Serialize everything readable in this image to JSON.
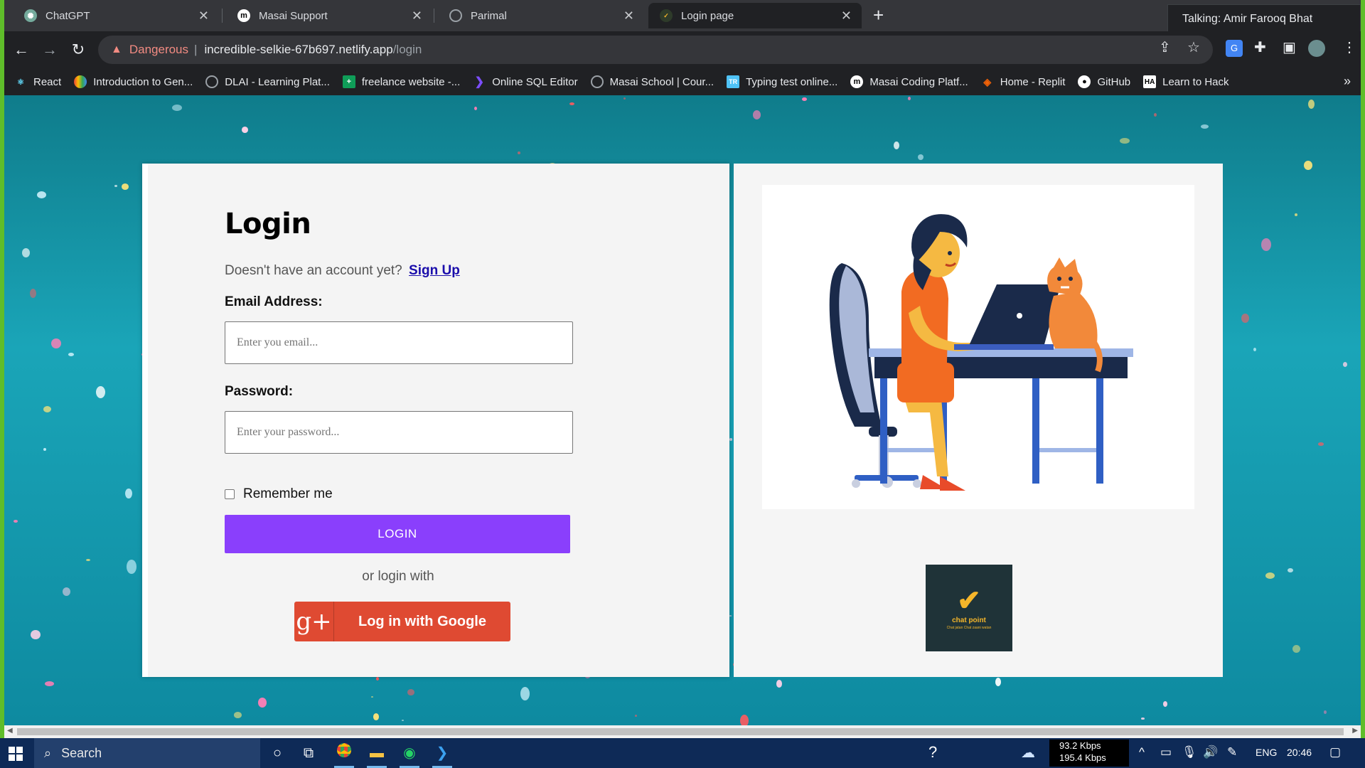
{
  "browser": {
    "tabs": [
      {
        "title": "ChatGPT",
        "icon": "chatgpt-icon",
        "active": false
      },
      {
        "title": "Masai Support",
        "icon": "masai-icon",
        "active": false
      },
      {
        "title": "Parimal",
        "icon": "globe-icon",
        "active": false
      },
      {
        "title": "Login page",
        "icon": "page-favicon",
        "active": true
      }
    ],
    "profile_chip": "Talking: Amir Farooq Bhat",
    "address": {
      "security_label": "Dangerous",
      "host": "incredible-selkie-67b697.netlify.app",
      "path": "/login"
    },
    "bookmarks": [
      {
        "label": "React",
        "icon": "react-icon",
        "color": "#61dafb"
      },
      {
        "label": "Introduction to Gen...",
        "icon": "gcloud-icon",
        "color": "#ea4335"
      },
      {
        "label": "DLAI - Learning Plat...",
        "icon": "globe-icon",
        "color": "#9aa0a6"
      },
      {
        "label": "freelance website -...",
        "icon": "plus-sheet-icon",
        "color": "#0f9d58"
      },
      {
        "label": "Online SQL Editor",
        "icon": "sql-icon",
        "color": "#7c4dff"
      },
      {
        "label": "Masai School | Cour...",
        "icon": "globe-icon",
        "color": "#9aa0a6"
      },
      {
        "label": "Typing test online...",
        "icon": "typing-icon",
        "color": "#4fc3f7"
      },
      {
        "label": "Masai Coding Platf...",
        "icon": "masai-icon",
        "color": "#ffffff"
      },
      {
        "label": "Home - Replit",
        "icon": "replit-icon",
        "color": "#f26207"
      },
      {
        "label": "GitHub",
        "icon": "github-icon",
        "color": "#ffffff"
      },
      {
        "label": "Learn to Hack",
        "icon": "hack-icon",
        "color": "#ffffff"
      }
    ]
  },
  "login": {
    "title": "Login",
    "signup_prompt": "Doesn't have an account yet?",
    "signup_link": "Sign Up",
    "email_label": "Email Address:",
    "email_placeholder": "Enter you email...",
    "password_label": "Password:",
    "password_placeholder": "Enter your password...",
    "remember_label": "Remember me",
    "login_button": "LOGIN",
    "or_text": "or login with",
    "google_icon_text": "g+",
    "google_button": "Log in with Google",
    "accent_color": "#8a3ffc",
    "google_color": "#df4a32"
  },
  "brand": {
    "name": "chat point",
    "tagline": "Chat jatan Chat zaani watan"
  },
  "taskbar": {
    "search_placeholder": "Search",
    "net_down": "93.2 Kbps",
    "net_up": "195.4 Kbps",
    "language": "ENG",
    "time": "20:46"
  }
}
